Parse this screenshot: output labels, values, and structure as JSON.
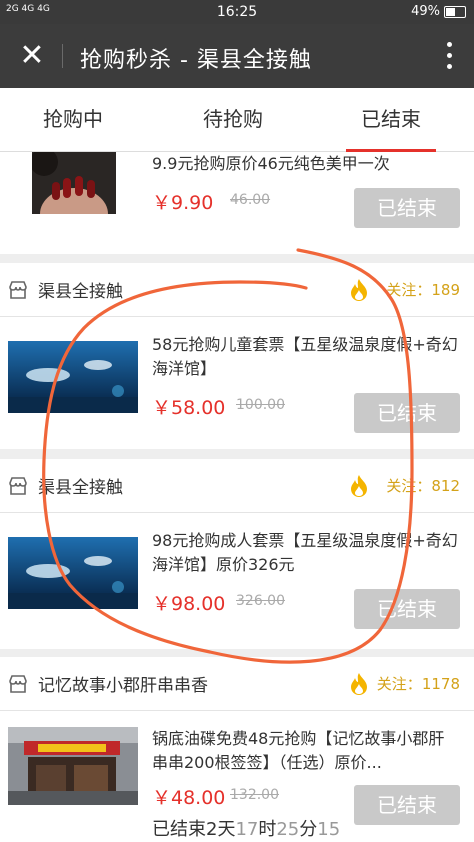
{
  "status_bar": {
    "signal": "2G 4G 4G",
    "time": "16:25",
    "battery": "49%"
  },
  "header": {
    "title": "抢购秒杀 - 渠县全接触"
  },
  "tabs": [
    {
      "label": "抢购中",
      "active": false
    },
    {
      "label": "待抢购",
      "active": false
    },
    {
      "label": "已结束",
      "active": true
    }
  ],
  "colors": {
    "accent": "#e5312b",
    "follow": "#d4a21a",
    "ended_button": "#c9c9c9",
    "annotation": "#f0663a"
  },
  "items": [
    {
      "shop": "",
      "followers": "",
      "title": "9.9元抢购原价46元纯色美甲一次",
      "price": "￥9.90",
      "old_price": "46.00",
      "status": "已结束",
      "image": "nail-photo"
    },
    {
      "shop": "渠县全接触",
      "followers_label": "关注：",
      "followers": "189",
      "title": "58元抢购儿童套票【五星级温泉度假+奇幻海洋馆】",
      "price": "￥58.00",
      "old_price": "100.00",
      "status": "已结束",
      "image": "aquarium-photo"
    },
    {
      "shop": "渠县全接触",
      "followers_label": "关注：",
      "followers": "812",
      "title": "98元抢购成人套票【五星级温泉度假+奇幻海洋馆】原价326元",
      "price": "￥98.00",
      "old_price": "326.00",
      "status": "已结束",
      "image": "aquarium-photo"
    },
    {
      "shop": "记忆故事小郡肝串串香",
      "followers_label": "关注：",
      "followers": "1178",
      "title": "锅底油碟免费48元抢购【记忆故事小郡肝串串200根签签】（任选）原价...",
      "price": "￥48.00",
      "old_price": "132.00",
      "status": "已结束",
      "image": "restaurant-photo",
      "countdown": {
        "prefix": "已结束",
        "days": "2",
        "d_label": "天",
        "hours": "17",
        "h_label": "时",
        "minutes": "25",
        "m_label": "分",
        "seconds": "15"
      }
    }
  ]
}
